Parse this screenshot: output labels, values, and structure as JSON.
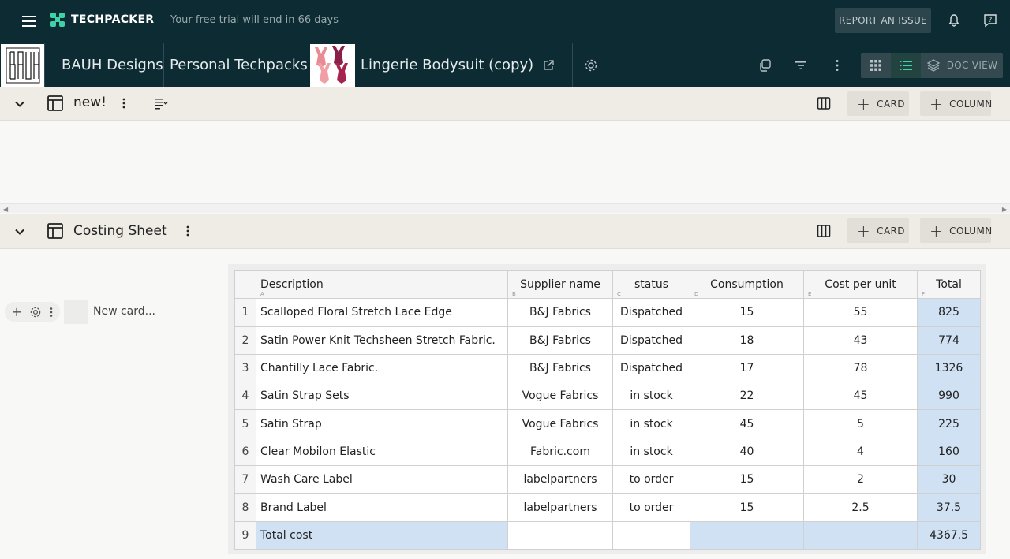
{
  "topbar": {
    "app_name": "TECHPACKER",
    "trial_text": "Your free trial will end in 66 days",
    "report_label": "REPORT AN ISSUE"
  },
  "navbar": {
    "brand_logo_text": "BAUH",
    "company": "BAUH Designs",
    "folder": "Personal Techpacks",
    "product": "Lingerie Bodysuit (copy)",
    "doc_view_label": "DOC VIEW"
  },
  "sections": [
    {
      "title": "new!",
      "card_label": "CARD",
      "column_label": "COLUMN"
    },
    {
      "title": "Costing Sheet",
      "card_label": "CARD",
      "column_label": "COLUMN"
    }
  ],
  "new_card": {
    "placeholder": "New card..."
  },
  "sheet": {
    "columns": [
      {
        "label": "Description",
        "ref": "A"
      },
      {
        "label": "Supplier name",
        "ref": "B"
      },
      {
        "label": "status",
        "ref": "C"
      },
      {
        "label": "Consumption",
        "ref": "D"
      },
      {
        "label": "Cost per unit",
        "ref": "E"
      },
      {
        "label": "Total",
        "ref": "F"
      }
    ],
    "rows": [
      {
        "n": "1",
        "desc": "Scalloped Floral Stretch Lace Edge",
        "supplier": "B&J Fabrics",
        "status": "Dispatched",
        "consumption": "15",
        "cost": "55",
        "total": "825"
      },
      {
        "n": "2",
        "desc": "Satin Power Knit Techsheen Stretch Fabric.",
        "supplier": "B&J Fabrics",
        "status": "Dispatched",
        "consumption": "18",
        "cost": "43",
        "total": "774"
      },
      {
        "n": "3",
        "desc": "Chantilly Lace Fabric.",
        "supplier": "B&J Fabrics",
        "status": "Dispatched",
        "consumption": "17",
        "cost": "78",
        "total": "1326"
      },
      {
        "n": "4",
        "desc": "Satin Strap Sets",
        "supplier": "Vogue Fabrics",
        "status": "in stock",
        "consumption": "22",
        "cost": "45",
        "total": "990"
      },
      {
        "n": "5",
        "desc": "Satin Strap",
        "supplier": "Vogue Fabrics",
        "status": "in stock",
        "consumption": "45",
        "cost": "5",
        "total": "225"
      },
      {
        "n": "6",
        "desc": "Clear Mobilon Elastic",
        "supplier": "Fabric.com",
        "status": "in stock",
        "consumption": "40",
        "cost": "4",
        "total": "160"
      },
      {
        "n": "7",
        "desc": "Wash Care Label",
        "supplier": "labelpartners",
        "status": "to order",
        "consumption": "15",
        "cost": "2",
        "total": "30"
      },
      {
        "n": "8",
        "desc": "Brand Label",
        "supplier": "labelpartners",
        "status": "to order",
        "consumption": "15",
        "cost": "2.5",
        "total": "37.5"
      }
    ],
    "total_row": {
      "n": "9",
      "label": "Total cost",
      "total": "4367.5"
    }
  },
  "icons": {
    "menu": "hamburger-menu-icon",
    "logo": "techpacker-logo-icon",
    "bell": "bell-icon",
    "help": "help-chat-icon",
    "external": "external-link-icon",
    "settings": "gear-icon",
    "copy": "copy-icon",
    "filter": "filter-icon",
    "more": "more-vertical-icon",
    "grid": "grid-view-icon",
    "list": "list-view-icon",
    "layers": "layers-icon",
    "chevron": "chevron-down-icon",
    "board": "board-layout-icon",
    "columns": "columns-icon"
  },
  "colors": {
    "topbar_bg": "#0d2b33",
    "section_bg": "#efece6",
    "highlight_cell": "#cfe1f2",
    "accent_green": "#3fd1a8"
  }
}
